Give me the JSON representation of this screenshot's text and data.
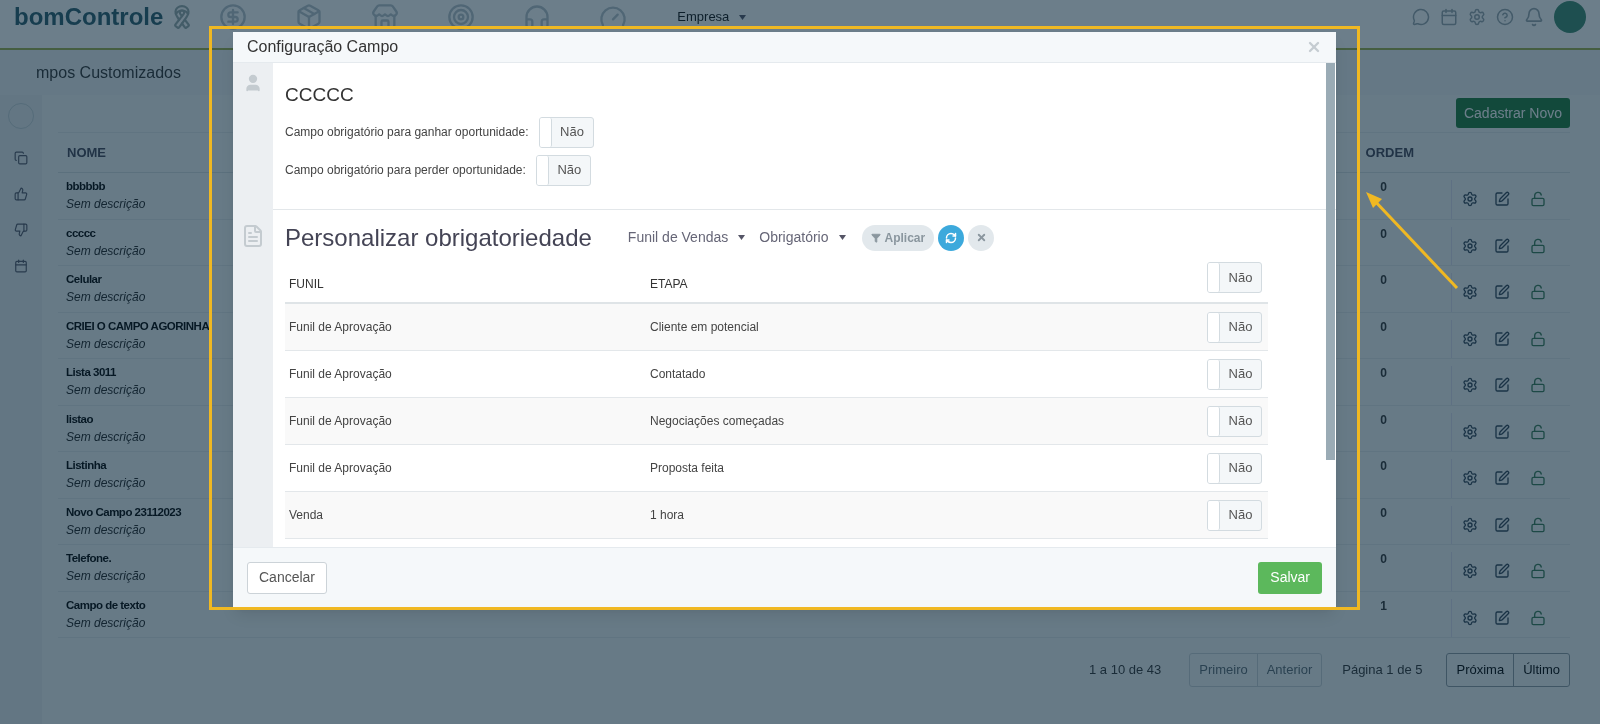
{
  "topbar": {
    "logo": "bomControle",
    "menu": "Empresa"
  },
  "page": {
    "title": "mpos Customizados",
    "new_button": "Cadastrar Novo",
    "columns": [
      "NOME",
      "ORDEM"
    ],
    "rows": [
      {
        "name": "bbbbbb",
        "description": "Sem descrição",
        "order": "0"
      },
      {
        "name": "ccccc",
        "description": "Sem descrição",
        "order": "0"
      },
      {
        "name": "Celular",
        "description": "Sem descrição",
        "order": "0"
      },
      {
        "name": "CRIEI O CAMPO AGORINHA",
        "description": "Sem descrição",
        "order": "0"
      },
      {
        "name": "Lista 3011",
        "description": "Sem descrição",
        "order": "0"
      },
      {
        "name": "listao",
        "description": "Sem descrição",
        "order": "0"
      },
      {
        "name": "Listinha",
        "description": "Sem descrição",
        "order": "0"
      },
      {
        "name": "Novo Campo 23112023",
        "description": "Sem descrição",
        "order": "0"
      },
      {
        "name": "Telefone.",
        "description": "Sem descrição",
        "order": "0"
      },
      {
        "name": "Campo de texto",
        "description": "Sem descrição",
        "order": "1"
      }
    ],
    "pagination": {
      "range": "1 a 10 de 43",
      "page_info": "Página 1 de 5",
      "buttons": [
        {
          "label": "Primeiro",
          "disabled": true
        },
        {
          "label": "Anterior",
          "disabled": true
        }
      ],
      "buttons_right": [
        {
          "label": "Próxima",
          "disabled": false
        },
        {
          "label": "Último",
          "disabled": false
        }
      ]
    }
  },
  "modal": {
    "title": "Configuração Campo",
    "field_name": "CCCCC",
    "settings": [
      {
        "label": "Campo obrigatório para ganhar oportunidade:",
        "on": false,
        "toggle_label": "Não"
      },
      {
        "label": "Campo obrigatório para perder oportunidade:",
        "on": false,
        "toggle_label": "Não"
      }
    ],
    "section_title": "Personalizar obrigatoriedade",
    "filters": [
      "Funil de Vendas",
      "Obrigatório"
    ],
    "apply_button": "Aplicar",
    "table": {
      "columns": [
        "FUNIL",
        "ETAPA"
      ],
      "header_toggle": {
        "on": false,
        "label": "Não"
      },
      "rows": [
        {
          "funil": "Funil de Aprovação",
          "etapa": "Cliente em potencial",
          "on": false,
          "toggle_label": "Não"
        },
        {
          "funil": "Funil de Aprovação",
          "etapa": "Contatado",
          "on": false,
          "toggle_label": "Não"
        },
        {
          "funil": "Funil de Aprovação",
          "etapa": "Negociações começadas",
          "on": false,
          "toggle_label": "Não"
        },
        {
          "funil": "Funil de Aprovação",
          "etapa": "Proposta feita",
          "on": false,
          "toggle_label": "Não"
        },
        {
          "funil": "Venda",
          "etapa": "1 hora",
          "on": false,
          "toggle_label": "Não"
        }
      ]
    },
    "cancel_button": "Cancelar",
    "save_button": "Salvar"
  }
}
